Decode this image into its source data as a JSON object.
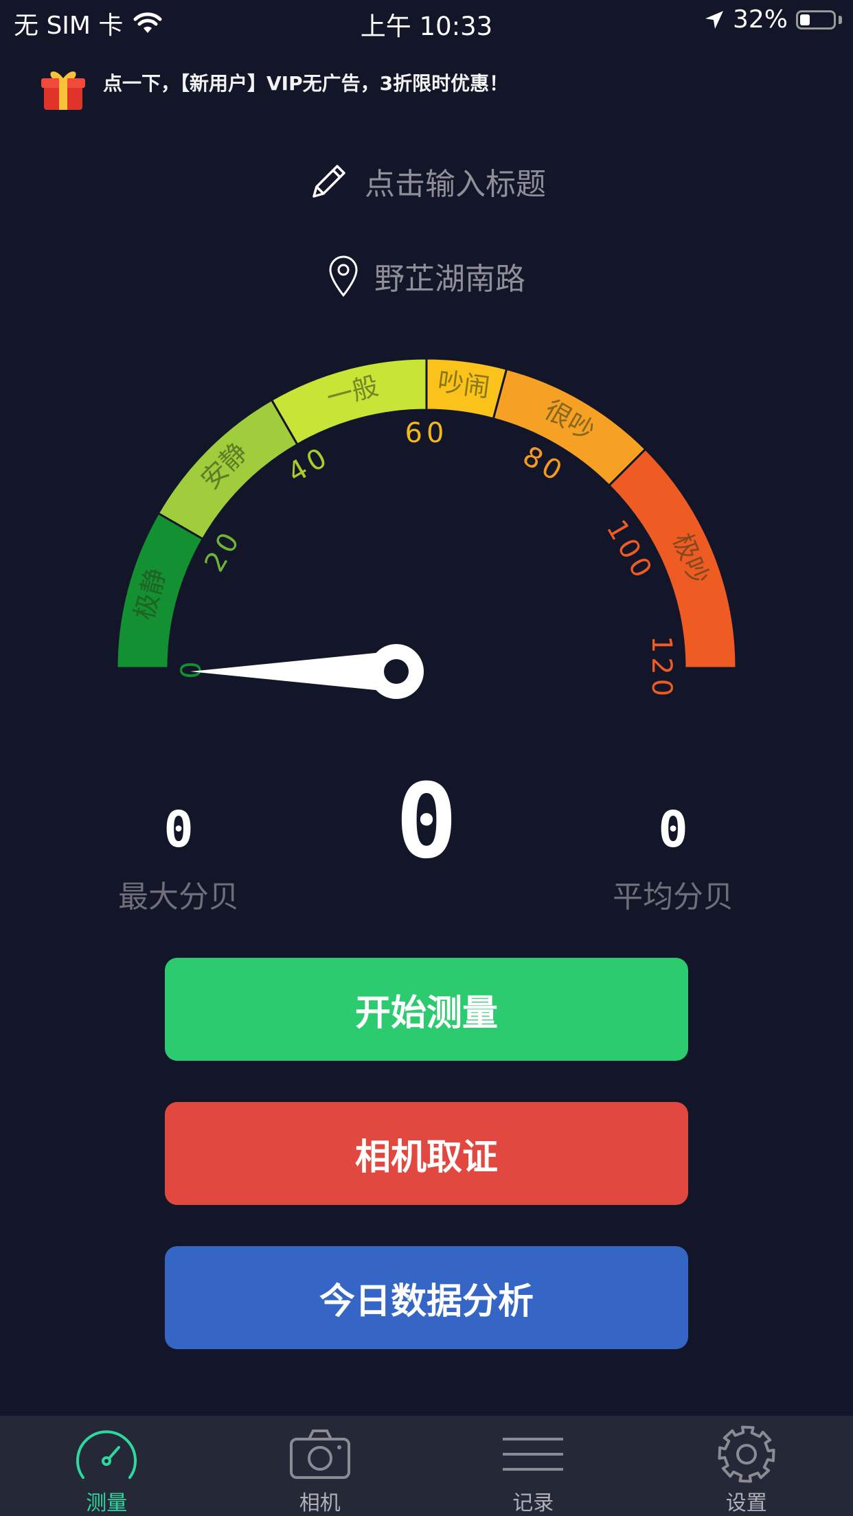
{
  "status_bar": {
    "carrier": "无 SIM 卡",
    "time": "上午 10:33",
    "battery": "32%",
    "battery_level": 0.32
  },
  "promo": {
    "text": "点一下，【新用户】VIP无广告，3折限时优惠！"
  },
  "title_input": {
    "placeholder": "点击输入标题"
  },
  "location": {
    "text": "野芷湖南路"
  },
  "gauge": {
    "value": 0,
    "min": 0,
    "max": 120,
    "ticks": [
      "0",
      "20",
      "40",
      "60",
      "80",
      "100",
      "120"
    ],
    "bands": [
      {
        "label": "极静",
        "from": 0,
        "to": 20,
        "color": "#129032"
      },
      {
        "label": "安静",
        "from": 20,
        "to": 40,
        "color": "#9fcd3b"
      },
      {
        "label": "一般",
        "from": 40,
        "to": 60,
        "color": "#c8e437"
      },
      {
        "label": "吵闹",
        "from": 60,
        "to": 70,
        "color": "#fbc21c"
      },
      {
        "label": "很吵",
        "from": 70,
        "to": 90,
        "color": "#f6a123"
      },
      {
        "label": "极吵",
        "from": 90,
        "to": 120,
        "color": "#ee5c24"
      }
    ],
    "tick_colors": [
      "#129032",
      "#6fb438",
      "#a8cd2a",
      "#f3b81b",
      "#f39a24",
      "#ee5c24",
      "#ee5c24"
    ]
  },
  "readouts": {
    "max": {
      "value": "0",
      "label": "最大分贝"
    },
    "current": {
      "value": "0"
    },
    "avg": {
      "value": "0",
      "label": "平均分贝"
    }
  },
  "buttons": {
    "start": "开始测量",
    "camera": "相机取证",
    "analysis": "今日数据分析"
  },
  "tabs": [
    {
      "label": "测量",
      "icon": "gauge-icon",
      "active": true
    },
    {
      "label": "相机",
      "icon": "camera-icon",
      "active": false
    },
    {
      "label": "记录",
      "icon": "list-icon",
      "active": false
    },
    {
      "label": "设置",
      "icon": "gear-icon",
      "active": false
    }
  ]
}
